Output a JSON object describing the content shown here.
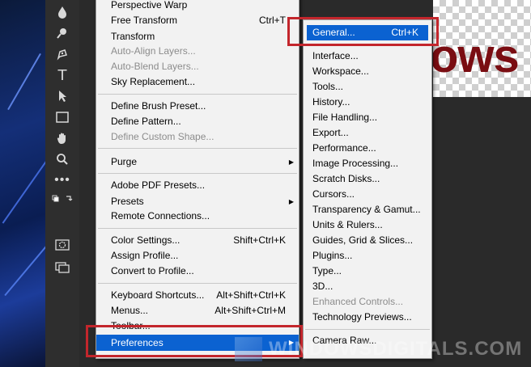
{
  "edit_menu": {
    "items": [
      {
        "label": "Perspective Warp",
        "shortcut": "",
        "disabled": false
      },
      {
        "label": "Free Transform",
        "shortcut": "Ctrl+T",
        "disabled": false
      },
      {
        "label": "Transform",
        "shortcut": "",
        "disabled": false
      },
      {
        "label": "Auto-Align Layers...",
        "shortcut": "",
        "disabled": true
      },
      {
        "label": "Auto-Blend Layers...",
        "shortcut": "",
        "disabled": true
      },
      {
        "label": "Sky Replacement...",
        "shortcut": "",
        "disabled": false
      },
      {
        "label": "Define Brush Preset...",
        "shortcut": "",
        "disabled": false
      },
      {
        "label": "Define Pattern...",
        "shortcut": "",
        "disabled": false
      },
      {
        "label": "Define Custom Shape...",
        "shortcut": "",
        "disabled": true
      },
      {
        "label": "Purge",
        "shortcut": "",
        "disabled": false
      },
      {
        "label": "Adobe PDF Presets...",
        "shortcut": "",
        "disabled": false
      },
      {
        "label": "Presets",
        "shortcut": "",
        "disabled": false
      },
      {
        "label": "Remote Connections...",
        "shortcut": "",
        "disabled": false
      },
      {
        "label": "Color Settings...",
        "shortcut": "Shift+Ctrl+K",
        "disabled": false
      },
      {
        "label": "Assign Profile...",
        "shortcut": "",
        "disabled": false
      },
      {
        "label": "Convert to Profile...",
        "shortcut": "",
        "disabled": false
      },
      {
        "label": "Keyboard Shortcuts...",
        "shortcut": "Alt+Shift+Ctrl+K",
        "disabled": false
      },
      {
        "label": "Menus...",
        "shortcut": "Alt+Shift+Ctrl+M",
        "disabled": false
      },
      {
        "label": "Toolbar...",
        "shortcut": "",
        "disabled": false
      },
      {
        "label": "Preferences",
        "shortcut": "",
        "disabled": false,
        "highlighted": true
      }
    ]
  },
  "preferences_menu": {
    "items": [
      {
        "label": "General...",
        "shortcut": "Ctrl+K",
        "highlighted": true
      },
      {
        "label": "Interface..."
      },
      {
        "label": "Workspace..."
      },
      {
        "label": "Tools..."
      },
      {
        "label": "History..."
      },
      {
        "label": "File Handling..."
      },
      {
        "label": "Export..."
      },
      {
        "label": "Performance..."
      },
      {
        "label": "Image Processing..."
      },
      {
        "label": "Scratch Disks..."
      },
      {
        "label": "Cursors..."
      },
      {
        "label": "Transparency & Gamut..."
      },
      {
        "label": "Units & Rulers..."
      },
      {
        "label": "Guides, Grid & Slices..."
      },
      {
        "label": "Plugins..."
      },
      {
        "label": "Type..."
      },
      {
        "label": "3D..."
      },
      {
        "label": "Enhanced Controls...",
        "disabled": true
      },
      {
        "label": "Technology Previews..."
      },
      {
        "label": "Camera Raw..."
      }
    ]
  },
  "canvas": {
    "visible_text": "ows"
  },
  "watermark": {
    "text": "WINDOWSDIGITALS.COM"
  },
  "colors": {
    "highlight": "#0b62d1",
    "annotation_box": "#c3262c",
    "menu_bg": "#f2f2f2",
    "canvas_text": "#7a0d12"
  },
  "toolbar": {
    "tools": [
      "blur-drop-icon",
      "dodge-icon",
      "pen-icon",
      "type-icon",
      "path-select-icon",
      "rectangle-icon",
      "hand-icon",
      "zoom-icon",
      "more-tools-icon",
      "swap-colors-icon",
      "color-swatches",
      "quick-mask-icon",
      "screen-mode-icon"
    ]
  }
}
